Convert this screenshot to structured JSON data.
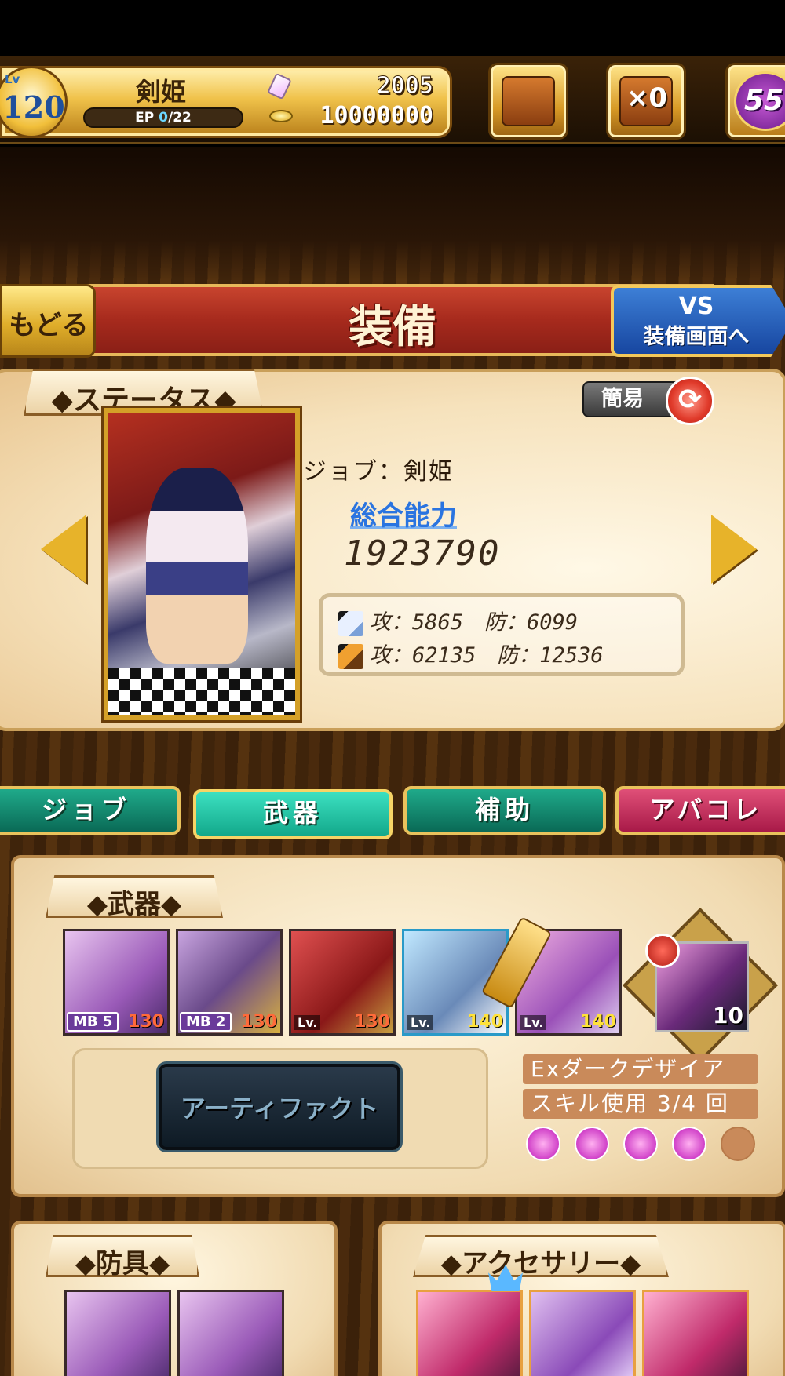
{
  "header": {
    "level_label": "Lv",
    "level": "120",
    "player_name": "剣姫",
    "ep_prefix": "EP ",
    "ep_current": "0",
    "ep_suffix": "/22",
    "gems": "2005",
    "coins": "10000000",
    "chest_count": "×0",
    "premium_count": "55",
    "colors": {
      "gold": "#f0c24a",
      "premium": "#6a1a8a"
    }
  },
  "title_bar": {
    "back_label": "もどる",
    "title": "装備",
    "vs_line1": "VS",
    "vs_line2": "装備画面へ"
  },
  "status": {
    "section_label": "◆ステータス◆",
    "simple_toggle_label": "簡易",
    "job_line": "ジョブ：剣姫",
    "power_label": "総合能力",
    "power_value": "1923790",
    "physical_row": "攻：5865　防：6099",
    "magic_row": "攻：62135　防：12536"
  },
  "tabs": [
    {
      "label": "ジョブ",
      "selected": false
    },
    {
      "label": "武器",
      "selected": true
    },
    {
      "label": "補助",
      "selected": false
    },
    {
      "label": "アバコレ",
      "selected": false
    }
  ],
  "weapons": {
    "section_label": "◆武器◆",
    "items": [
      {
        "tag": "MB 5",
        "level": "130"
      },
      {
        "tag": "MB 2",
        "level": "130"
      },
      {
        "tag": "Lv.",
        "level": "130"
      },
      {
        "tag": "Lv.",
        "level": "140"
      },
      {
        "tag": "Lv.",
        "level": "140"
      }
    ],
    "special_count": "10",
    "artifact_label": "アーティファクト",
    "skill_name": "Exダークデザイア",
    "skill_usage": "スキル使用 3/4 回",
    "skill_orbs_filled": 4,
    "skill_orbs_total": 5
  },
  "armor": {
    "section_label": "◆防具◆"
  },
  "accessories": {
    "section_label": "◆アクセサリー◆"
  }
}
